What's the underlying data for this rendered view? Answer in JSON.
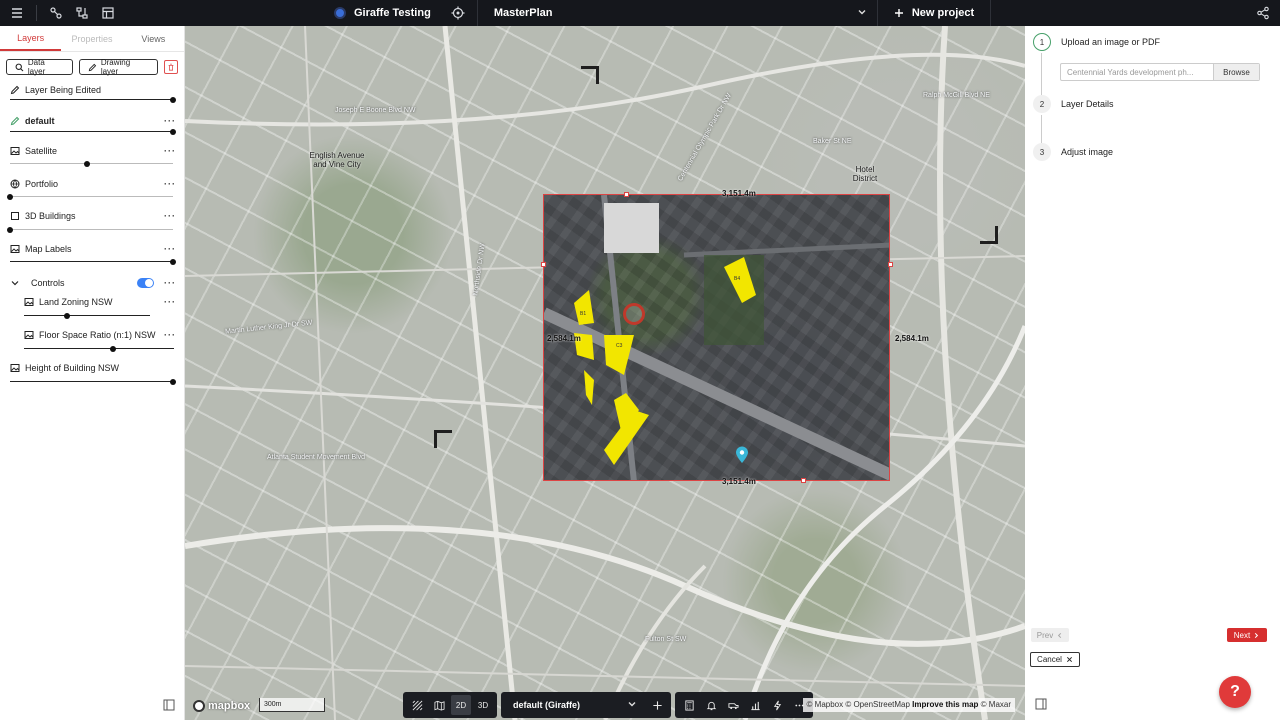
{
  "topbar": {
    "project_name": "Giraffe Testing",
    "plan_name": "MasterPlan",
    "new_project_label": "New project",
    "icons": [
      "menu-icon",
      "nodes-icon",
      "flow-icon",
      "table-icon",
      "target-icon",
      "chevron-down-icon",
      "plus-icon",
      "share-icon"
    ]
  },
  "left_panel": {
    "tabs": [
      "Layers",
      "Properties",
      "Views"
    ],
    "active_tab": "Layers",
    "buttons": {
      "data_layer": "Data layer",
      "drawing_layer": "Drawing layer"
    },
    "layers": [
      {
        "label": "Layer Being Edited",
        "icon": "pencil-icon",
        "slider": 1.0
      },
      {
        "label": "default",
        "icon": "pencil-icon",
        "slider": 1.0
      },
      {
        "label": "Satellite",
        "icon": "image-icon",
        "slider": 0.47
      },
      {
        "label": "Portfolio",
        "icon": "globe-icon",
        "slider": 0.0
      },
      {
        "label": "3D Buildings",
        "icon": "cube-icon",
        "slider": 0.0
      },
      {
        "label": "Map Labels",
        "icon": "image-icon",
        "slider": 1.0
      }
    ],
    "group": {
      "label": "Controls",
      "enabled": true,
      "children": [
        {
          "label": "Land Zoning NSW",
          "icon": "image-icon",
          "slider": 0.34
        },
        {
          "label": "Floor Space Ratio (n:1) NSW",
          "icon": "image-icon",
          "slider": 0.59
        }
      ]
    },
    "last_layer": {
      "label": "Height of Building NSW",
      "icon": "image-icon",
      "slider": 1.0
    },
    "more_glyph": "···"
  },
  "map": {
    "labels": [
      "English Avenue and Vine City",
      "Joseph E Boone Blvd NW",
      "Martin Luther King Jr Dr SW",
      "Atlanta Student Movement Blvd",
      "Centennial Olympic Park Dr NW",
      "Ralph McGill Blvd NE",
      "Baker St NE",
      "Hotel District",
      "Northside Dr NW",
      "Fulton St SW"
    ],
    "dimensions": {
      "top": "3,151.4m",
      "bottom": "3,151.4m",
      "left": "2,584.1m",
      "right": "2,584.1m"
    },
    "scale_label": "300m",
    "logo": "mapbox",
    "attribution": {
      "mapbox": "© Mapbox",
      "osm": "© OpenStreetMap",
      "improve": "Improve this map",
      "maxar": "© Maxar"
    },
    "toolbar": {
      "mode_2d": "2D",
      "mode_3d": "3D",
      "active_mode": "2D",
      "layer_select": "default (Giraffe)"
    }
  },
  "right_panel": {
    "steps": [
      {
        "number": "1",
        "label": "Upload an image or PDF",
        "active": true
      },
      {
        "number": "2",
        "label": "Layer Details",
        "active": false
      },
      {
        "number": "3",
        "label": "Adjust image",
        "active": false
      }
    ],
    "upload": {
      "placeholder": "Centennial Yards development ph...",
      "browse_label": "Browse"
    },
    "prev_label": "Prev",
    "next_label": "Next",
    "cancel_label": "Cancel",
    "help_label": "?",
    "colors": {
      "accent": "#d62f2f",
      "step_active": "#47a06a",
      "toggle": "#3b82f6"
    }
  }
}
